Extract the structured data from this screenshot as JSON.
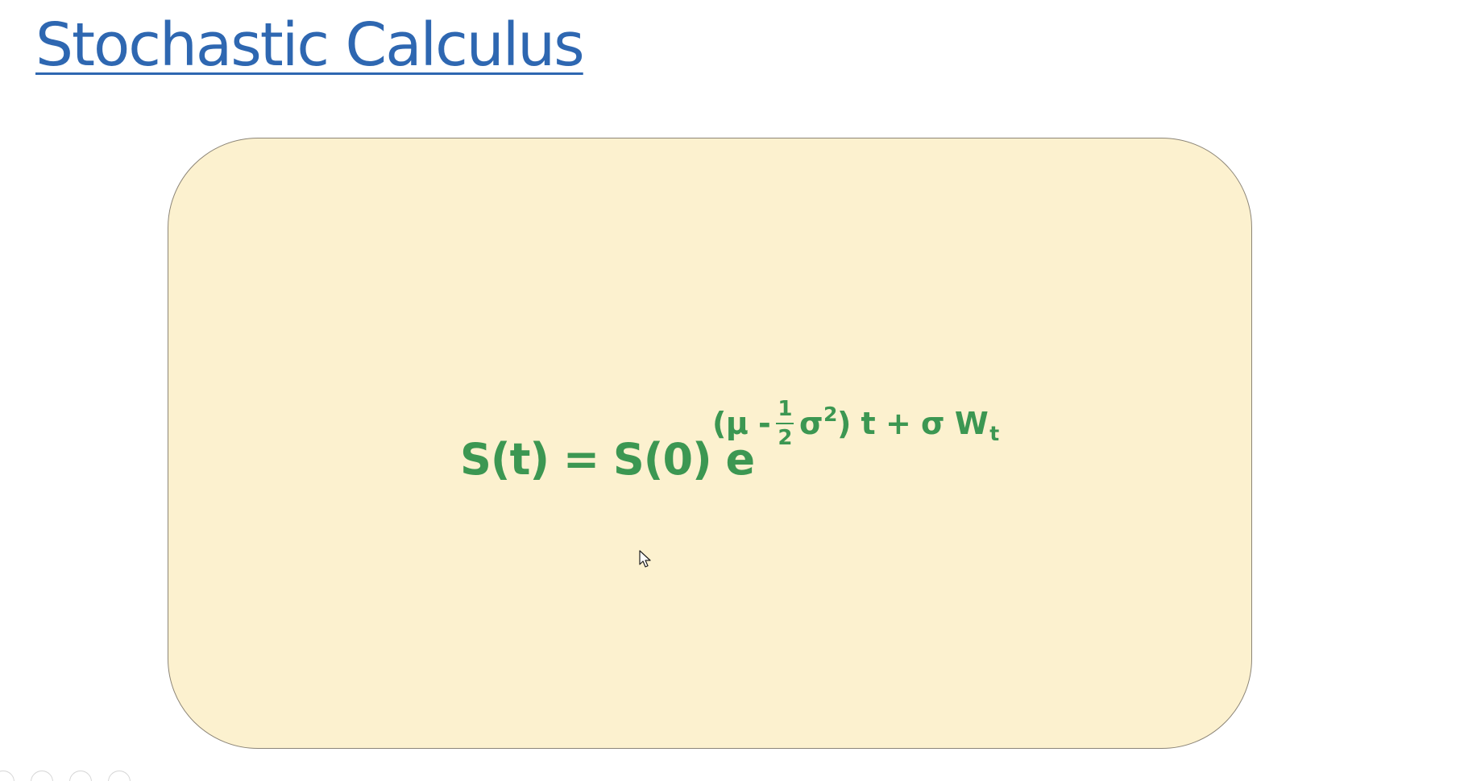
{
  "slide": {
    "title": "Stochastic Calculus"
  },
  "formula": {
    "lhs": "S(t) = S(0) e",
    "exp_open": "(μ - ",
    "frac_num": "1",
    "frac_den": "2",
    "sigma_sq": "σ",
    "sigma_sq_power": "2",
    "exp_close": ") t + σ W",
    "wiener_subscript": "t"
  },
  "colors": {
    "title": "#2e67b1",
    "formula": "#3c9752",
    "box_fill": "#fcf1cf",
    "box_border": "#8c8577"
  },
  "icons": {
    "cursor": "mouse-pointer-icon"
  }
}
